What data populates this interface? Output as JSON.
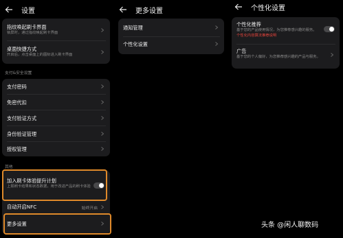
{
  "panel1": {
    "title": "设置",
    "card1": [
      {
        "title": "指纹唤起刷卡界面",
        "sub": "锁屏时，通过指纹唤起刷卡界面"
      },
      {
        "title": "桌面快捷方式",
        "sub": "开启后，点击桌面上的图标进入刷卡界面"
      }
    ],
    "section_security": "支付&安全设置",
    "card2": [
      "支付密码",
      "免密代扣",
      "支付验证方式",
      "身份验证管理",
      "授权管理"
    ],
    "section_other": "其他",
    "improve": {
      "title": "加入刷卡体验提升计划",
      "sub": "上报刷卡结果和状态数据，用于改进产品的刷卡体验"
    },
    "auto_nfc": {
      "title": "自动开启NFC",
      "value": "始终开启"
    },
    "more": {
      "title": "更多设置"
    }
  },
  "panel2": {
    "title": "更多设置",
    "items": [
      "通知管理",
      "个性化设置"
    ]
  },
  "panel3": {
    "title": "个性化设置",
    "personal": {
      "title": "个性化推荐",
      "sub": "基于您的产品使用情况，为您推荐感兴趣的服务。",
      "link": "个性化内容算法推荐说明"
    },
    "ads": {
      "title": "广告",
      "sub": "基于您的个人偏好，为您推荐感兴趣的产品与服务。"
    }
  },
  "watermark": "头条 @闲人聊数码",
  "colors": {
    "background": "#000000",
    "card": "#1c1c1e",
    "highlight": "#e08a2a",
    "link": "#e8453c"
  }
}
